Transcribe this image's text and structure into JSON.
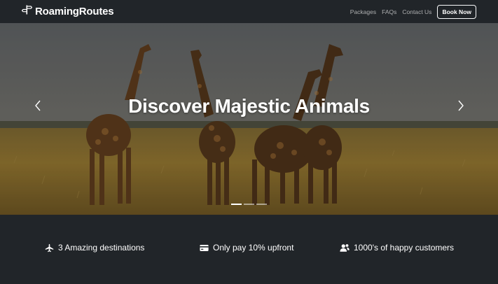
{
  "brand": {
    "name": "RoamingRoutes",
    "icon": "signpost-icon"
  },
  "nav": {
    "links": [
      "Packages",
      "FAQs",
      "Contact Us"
    ],
    "cta": "Book Now"
  },
  "hero": {
    "caption": "Discover Majestic Animals",
    "slides_count": 3,
    "active_slide": 1,
    "prev_icon": "chevron-left-icon",
    "next_icon": "chevron-right-icon"
  },
  "features": [
    {
      "icon": "airplane-icon",
      "text": "3 Amazing destinations"
    },
    {
      "icon": "credit-card-icon",
      "text": "Only pay 10% upfront"
    },
    {
      "icon": "users-icon",
      "text": "1000's of happy customers"
    }
  ],
  "colors": {
    "background": "#212529",
    "text": "#ffffff",
    "nav_link": "rgba(255,255,255,0.62)"
  }
}
